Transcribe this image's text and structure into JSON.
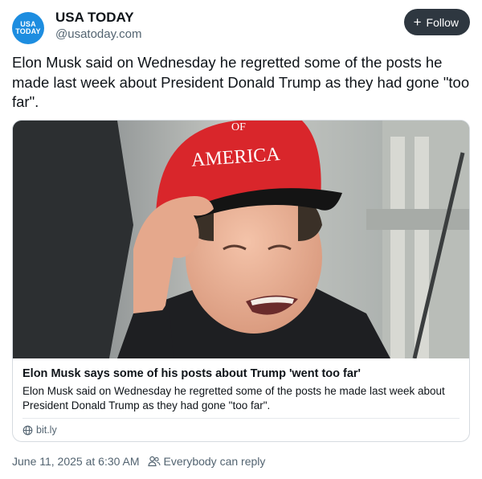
{
  "account": {
    "name": "USA TODAY",
    "handle": "@usatoday.com",
    "avatar_text_line1": "USA",
    "avatar_text_line2": "TODAY",
    "avatar_color": "#1d8de0"
  },
  "follow_button": {
    "plus": "+",
    "label": "Follow"
  },
  "post": {
    "text": "Elon Musk said on Wednesday he regretted some of the posts he made last week about President Donald Trump as they had gone \"too far\"."
  },
  "link_card": {
    "image_icon": "photo-of-man-in-red-cap",
    "hat_text_line1": "OF",
    "hat_text_line2": "AMERICA",
    "title": "Elon Musk says some of his posts about Trump 'went too far'",
    "description": "Elon Musk said on Wednesday he regretted some of the posts he made last week about President Donald Trump as they had gone \"too far\".",
    "domain": "bit.ly",
    "domain_icon": "globe-icon"
  },
  "footer": {
    "timestamp": "June 11, 2025 at 6:30 AM",
    "reply_setting": "Everybody can reply",
    "reply_icon": "people-icon"
  }
}
